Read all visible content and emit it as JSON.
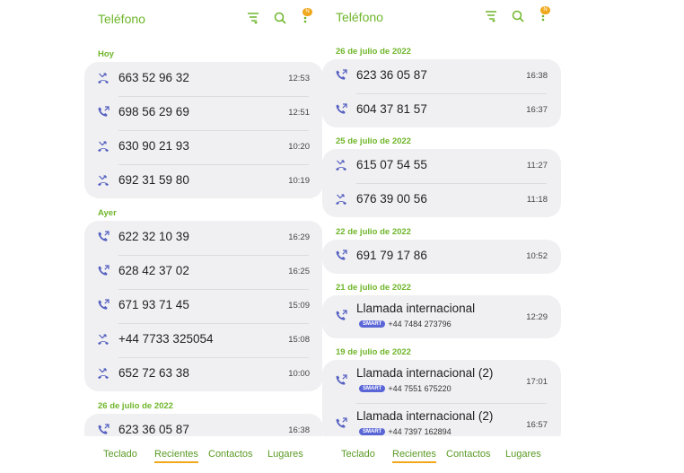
{
  "left": {
    "title": "Teléfono",
    "sections": [
      {
        "label": "Hoy",
        "calls": [
          {
            "type": "missed",
            "number": "663 52 96 32",
            "time": "12:53"
          },
          {
            "type": "outgoing",
            "number": "698 56 29 69",
            "time": "12:51"
          },
          {
            "type": "missed",
            "number": "630 90 21 93",
            "time": "10:20"
          },
          {
            "type": "missed",
            "number": "692 31 59 80",
            "time": "10:19"
          }
        ]
      },
      {
        "label": "Ayer",
        "calls": [
          {
            "type": "outgoing",
            "number": "622 32 10 39",
            "time": "16:29"
          },
          {
            "type": "outgoing",
            "number": "628 42 37 02",
            "time": "16:25"
          },
          {
            "type": "outgoing",
            "number": "671 93 71 45",
            "time": "15:09"
          },
          {
            "type": "missed",
            "number": "+44 7733 325054",
            "time": "15:08"
          },
          {
            "type": "missed",
            "number": "652 72 63 38",
            "time": "10:00"
          }
        ]
      },
      {
        "label": "26 de julio de 2022",
        "calls": [
          {
            "type": "outgoing",
            "number": "623 36 05 87",
            "time": "16:38"
          }
        ]
      }
    ]
  },
  "right": {
    "title": "Teléfono",
    "sections": [
      {
        "label": "26 de julio de 2022",
        "calls": [
          {
            "type": "outgoing",
            "number": "623 36 05 87",
            "time": "16:38"
          },
          {
            "type": "outgoing",
            "number": "604 37 81 57",
            "time": "16:37"
          }
        ]
      },
      {
        "label": "25 de julio de 2022",
        "calls": [
          {
            "type": "missed",
            "number": "615 07 54 55",
            "time": "11:27"
          },
          {
            "type": "missed",
            "number": "676 39 00 56",
            "time": "11:18"
          }
        ]
      },
      {
        "label": "22 de julio de 2022",
        "calls": [
          {
            "type": "outgoing",
            "number": "691 79 17 86",
            "time": "10:52"
          }
        ]
      },
      {
        "label": "21 de julio de 2022",
        "calls": [
          {
            "type": "outgoing",
            "number": "Llamada internacional",
            "badge": "SMART",
            "sub": "+44 7484 273796",
            "time": "12:29"
          }
        ]
      },
      {
        "label": "19 de julio de 2022",
        "calls": [
          {
            "type": "outgoing",
            "number": "Llamada internacional (2)",
            "badge": "SMART",
            "sub": "+44 7551 675220",
            "time": "17:01"
          },
          {
            "type": "outgoing",
            "number": "Llamada internacional (2)",
            "badge": "SMART",
            "sub": "+44 7397 162894",
            "time": "16:57"
          }
        ]
      }
    ]
  },
  "notification_badge": "N",
  "tabs": [
    {
      "label": "Teclado",
      "active": false
    },
    {
      "label": "Recientes",
      "active": true
    },
    {
      "label": "Contactos",
      "active": false
    },
    {
      "label": "Lugares",
      "active": false
    }
  ],
  "colors": {
    "accent": "#6fb62a",
    "tab_indicator": "#f0a81c",
    "call_icon": "#5560c0",
    "card": "#f0f0f2"
  }
}
